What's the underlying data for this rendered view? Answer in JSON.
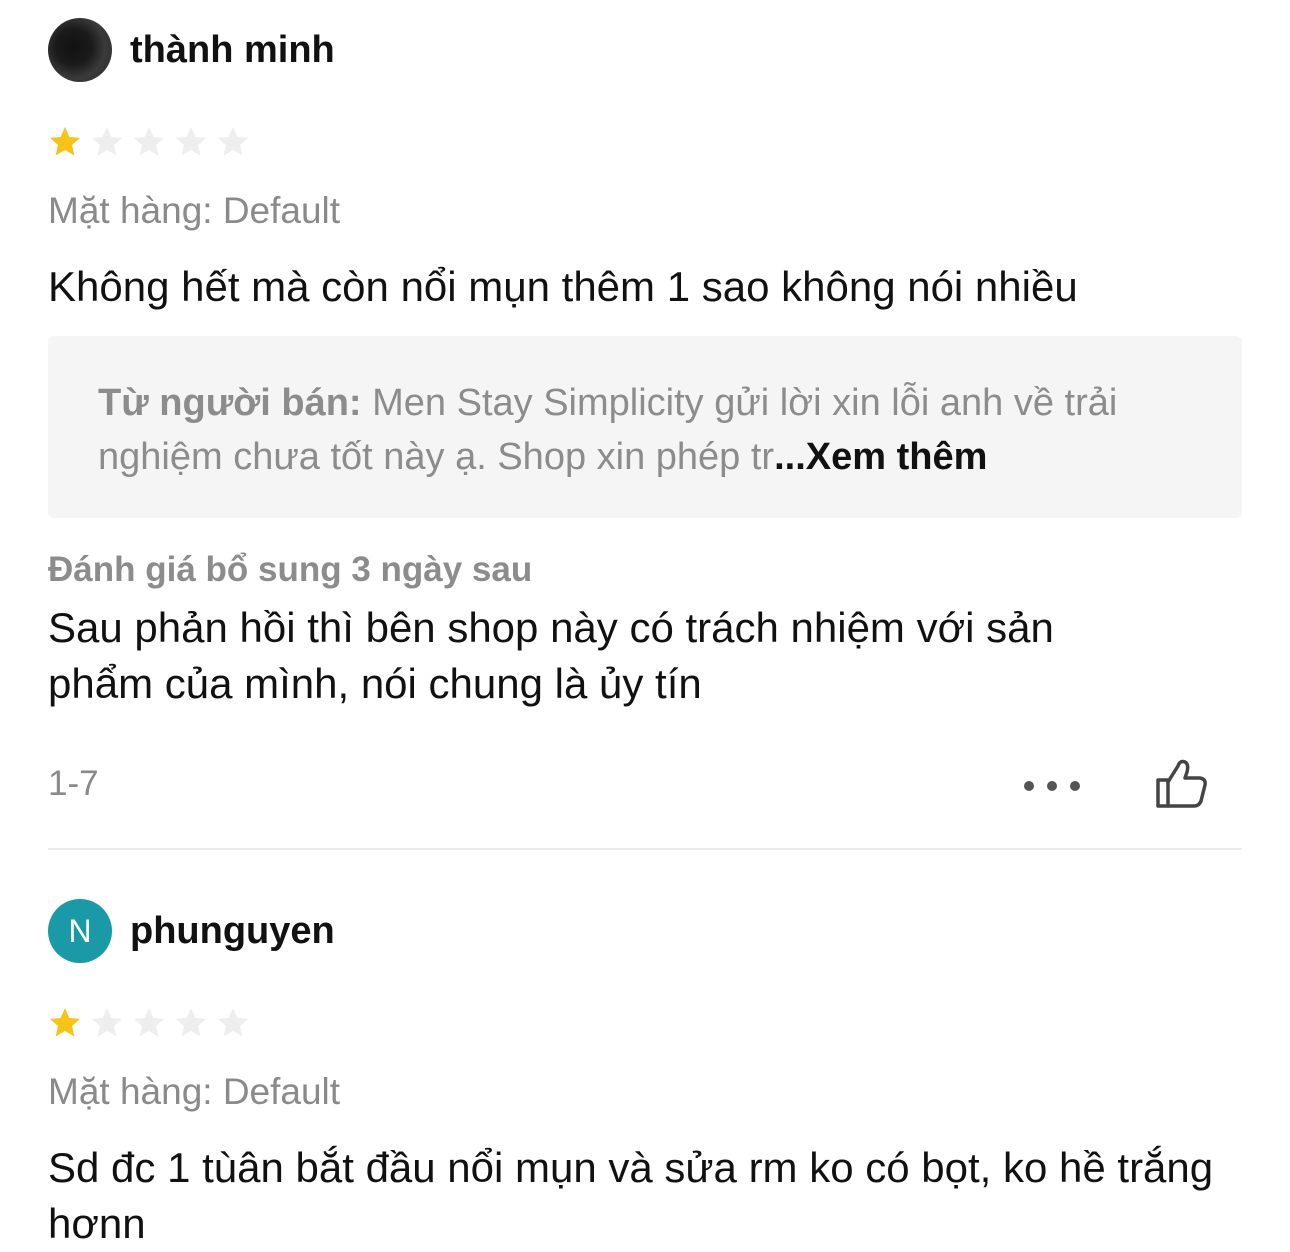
{
  "reviews": [
    {
      "username": "thành minh",
      "avatar_type": "photo",
      "rating": 1,
      "max_rating": 5,
      "variant": "Mặt hàng: Default",
      "content": "Không hết mà còn nổi mụn thêm 1 sao không nói nhiều",
      "seller_reply": {
        "label": "Từ người bán:",
        "text": "Men Stay Simplicity gửi lời xin lỗi anh về trải nghiệm chưa tốt này ạ. Shop xin phép tr",
        "see_more": "...Xem thêm"
      },
      "followup": {
        "label": "Đánh giá bổ sung 3 ngày sau",
        "text": "Sau phản hồi thì bên shop này có trách nhiệm với sản phẩm của mình, nói chung là ủy tín"
      },
      "date": "1-7",
      "more_icon": "more-horizontal-icon",
      "like_icon": "thumbs-up-icon"
    },
    {
      "username": "phunguyen",
      "avatar_type": "letter",
      "avatar_letter": "N",
      "avatar_color": "#1a9aa6",
      "rating": 1,
      "max_rating": 5,
      "variant": "Mặt hàng: Default",
      "content": "Sd đc 1 tùân bắt đầu nổi mụn và sửa rm ko có bọt, ko hề trắng hơnn"
    }
  ],
  "colors": {
    "star_filled": "#f6c417",
    "star_empty": "#eeeeee",
    "muted_text": "#8c8c8c",
    "seller_box_bg": "#f5f5f5"
  }
}
